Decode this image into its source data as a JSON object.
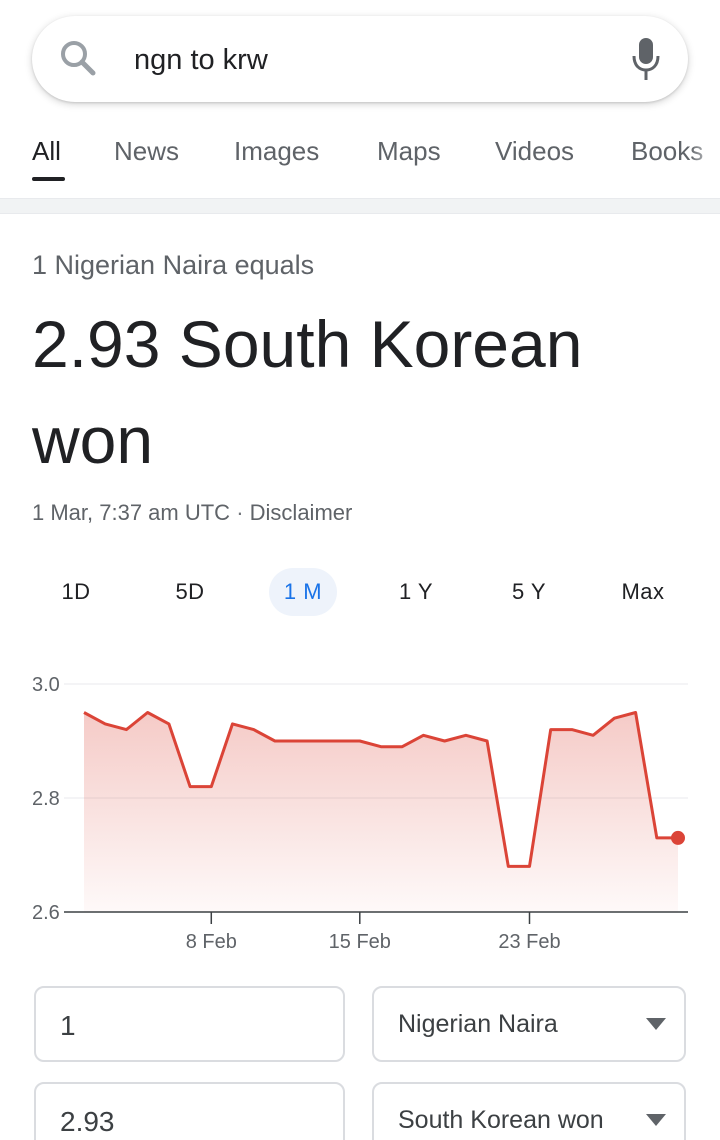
{
  "search": {
    "query": "ngn to krw"
  },
  "tabs": [
    {
      "label": "All",
      "active": true
    },
    {
      "label": "News"
    },
    {
      "label": "Images"
    },
    {
      "label": "Maps"
    },
    {
      "label": "Videos"
    },
    {
      "label": "Books"
    }
  ],
  "converter": {
    "equals_label": "1 Nigerian Naira equals",
    "result_line1": "2.93 South Korean",
    "result_line2": "won",
    "timestamp": "1 Mar, 7:37 am UTC",
    "separator": "·",
    "disclaimer": "Disclaimer"
  },
  "ranges": [
    {
      "label": "1D"
    },
    {
      "label": "5D"
    },
    {
      "label": "1 M",
      "active": true
    },
    {
      "label": "1 Y"
    },
    {
      "label": "5 Y"
    },
    {
      "label": "Max"
    }
  ],
  "chart_data": {
    "type": "area",
    "title": "",
    "xlabel": "",
    "ylabel": "",
    "ylim": [
      2.6,
      3.0
    ],
    "yticks": [
      "3.0",
      "2.8",
      "2.6"
    ],
    "xticks": [
      "8 Feb",
      "15 Feb",
      "23 Feb"
    ],
    "xtick_index": [
      6,
      13,
      21
    ],
    "series": [
      {
        "color": "#db4437",
        "values": [
          2.95,
          2.93,
          2.92,
          2.95,
          2.93,
          2.82,
          2.82,
          2.93,
          2.92,
          2.9,
          2.9,
          2.9,
          2.9,
          2.9,
          2.89,
          2.89,
          2.91,
          2.9,
          2.91,
          2.9,
          2.68,
          2.68,
          2.92,
          2.92,
          2.91,
          2.94,
          2.95,
          2.73,
          2.73
        ]
      }
    ]
  },
  "amounts": {
    "from_value": "1",
    "from_currency": "Nigerian Naira",
    "to_value": "2.93",
    "to_currency": "South Korean won"
  },
  "colors": {
    "accent": "#1a73e8",
    "chart_line": "#db4437"
  }
}
